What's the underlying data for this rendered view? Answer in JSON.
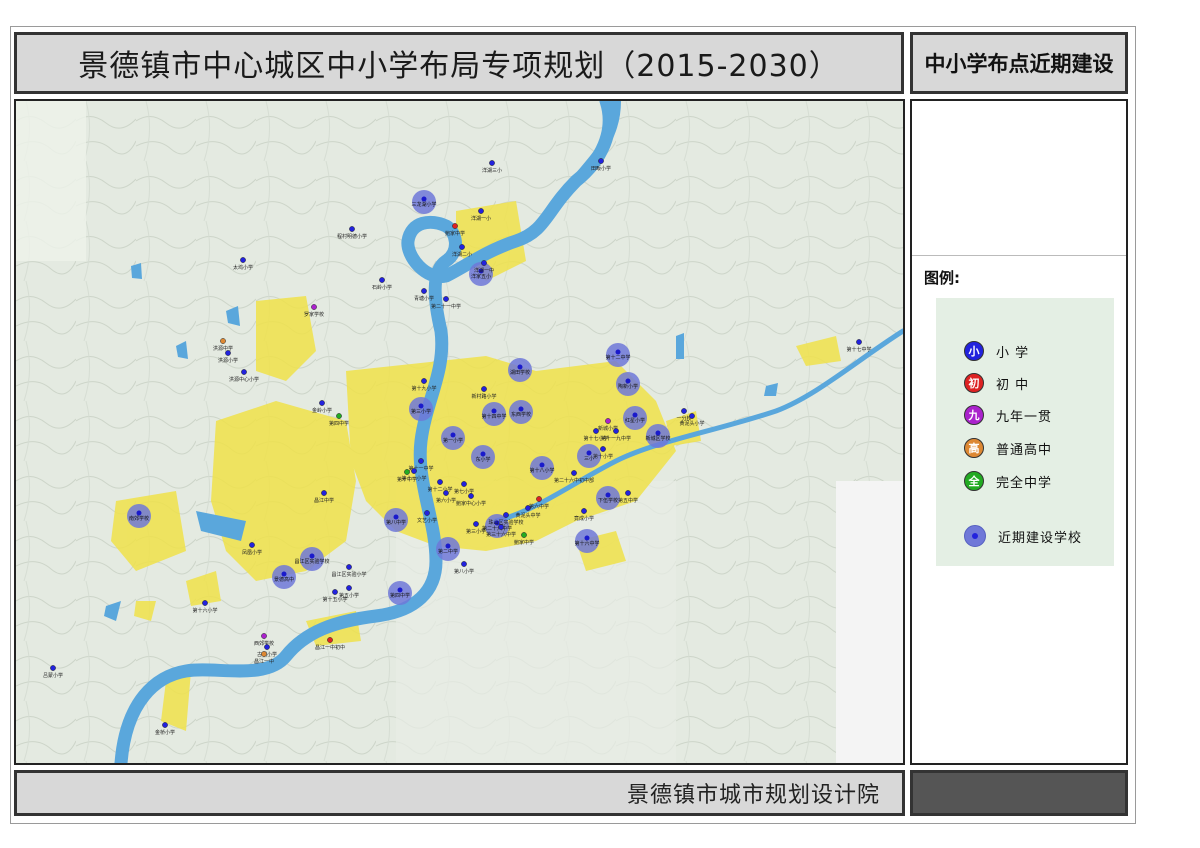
{
  "header": {
    "title": "景德镇市中心城区中小学布局专项规划（2015-2030）",
    "subtitle": "中小学布点近期建设"
  },
  "legend": {
    "title": "图例:",
    "items": [
      {
        "glyph": "小",
        "label": "小    学",
        "color": "#2222dd"
      },
      {
        "glyph": "初",
        "label": "初    中",
        "color": "#dd2222"
      },
      {
        "glyph": "九",
        "label": "九年一贯",
        "color": "#aa22cc"
      },
      {
        "glyph": "高",
        "label": "普通高中",
        "color": "#dd8833"
      },
      {
        "glyph": "全",
        "label": "完全中学",
        "color": "#22aa22"
      }
    ],
    "planned": {
      "label": "近期建设学校",
      "color": "#6f78d8"
    }
  },
  "footer": {
    "institute": "景德镇市城市规划设计院"
  },
  "colors": {
    "river": "#5aa7dc",
    "urban": "#f0e24a",
    "terrain": "#dfe6dc",
    "planned_circle": "#6f78d8"
  },
  "map": {
    "planned_schools": [
      {
        "label": "三龙湖小学"
      },
      {
        "label": "洋家五小"
      },
      {
        "label": "南郊学校"
      },
      {
        "label": "第十二中学"
      },
      {
        "label": "陶新小学"
      },
      {
        "label": "新城区学校"
      },
      {
        "label": "第三小学"
      },
      {
        "label": "第一小学"
      },
      {
        "label": "第十四中学"
      },
      {
        "label": "东小学"
      },
      {
        "label": "湖田学校"
      },
      {
        "label": "第十八小学"
      },
      {
        "label": "三小"
      },
      {
        "label": "第二十六中学"
      },
      {
        "label": "第二中学"
      },
      {
        "label": "下伍学校"
      },
      {
        "label": "第十六中学"
      },
      {
        "label": "第八中学"
      },
      {
        "label": "第四中学"
      },
      {
        "label": "昌江区实验学校"
      },
      {
        "label": "景德高中"
      },
      {
        "label": "红星小学"
      },
      {
        "label": "东西学校"
      }
    ],
    "schools": [
      {
        "label": "洋湖三小",
        "type": "小"
      },
      {
        "label": "田畈小学",
        "type": "小"
      },
      {
        "label": "洋湖一小",
        "type": "小"
      },
      {
        "label": "鲍家中学",
        "type": "初"
      },
      {
        "label": "洋湖二小",
        "type": "小"
      },
      {
        "label": "洋湖一中",
        "type": "小"
      },
      {
        "label": "程村明德小学",
        "type": "小"
      },
      {
        "label": "石岭小学",
        "type": "小"
      },
      {
        "label": "青塘小学",
        "type": "小"
      },
      {
        "label": "第二十一中学",
        "type": "小"
      },
      {
        "label": "太坞小学",
        "type": "小"
      },
      {
        "label": "罗家学校",
        "type": "九"
      },
      {
        "label": "洪源中学",
        "type": "高"
      },
      {
        "label": "洪源小学",
        "type": "小"
      },
      {
        "label": "洪源中心小学",
        "type": "小"
      },
      {
        "label": "金岭小学",
        "type": "小"
      },
      {
        "label": "第四中学",
        "type": "全"
      },
      {
        "label": "第十九小学",
        "type": "小"
      },
      {
        "label": "新村路小学",
        "type": "小"
      },
      {
        "label": "第十一中学",
        "type": "小"
      },
      {
        "label": "第十一小学",
        "type": "小"
      },
      {
        "label": "第十中学",
        "type": "全"
      },
      {
        "label": "第十二小学",
        "type": "小"
      },
      {
        "label": "第六小学",
        "type": "小"
      },
      {
        "label": "第七小学",
        "type": "小"
      },
      {
        "label": "文艺小学",
        "type": "小"
      },
      {
        "label": "第三小学",
        "type": "小"
      },
      {
        "label": "第三十六中学",
        "type": "小"
      },
      {
        "label": "第八小学",
        "type": "小"
      },
      {
        "label": "昌江区实验小学",
        "type": "小"
      },
      {
        "label": "第五小学",
        "type": "小"
      },
      {
        "label": "第十五小学",
        "type": "小"
      },
      {
        "label": "第十六小学",
        "type": "小"
      },
      {
        "label": "西郊学校",
        "type": "九"
      },
      {
        "label": "古城小学",
        "type": "小"
      },
      {
        "label": "昌江一中",
        "type": "高"
      },
      {
        "label": "昌江一中初中",
        "type": "初"
      },
      {
        "label": "吕蒙小学",
        "type": "小"
      },
      {
        "label": "金桥小学",
        "type": "小"
      },
      {
        "label": "凤凰小学",
        "type": "小"
      },
      {
        "label": "昌江中学",
        "type": "小"
      },
      {
        "label": "新城小学",
        "type": "九"
      },
      {
        "label": "第十一九中学",
        "type": "小"
      },
      {
        "label": "第十七小学",
        "type": "小"
      },
      {
        "label": "第十小学",
        "type": "小"
      },
      {
        "label": "一分校",
        "type": "小"
      },
      {
        "label": "黄泥头小学",
        "type": "小"
      },
      {
        "label": "黄泥头中学",
        "type": "小"
      },
      {
        "label": "竟成小学",
        "type": "小"
      },
      {
        "label": "珠山区实验学校",
        "type": "小"
      },
      {
        "label": "第二十六中初中部",
        "type": "小"
      },
      {
        "label": "第十七中学",
        "type": "小"
      },
      {
        "label": "鲍家中心小学",
        "type": "小"
      },
      {
        "label": "鲍家中学",
        "type": "全"
      },
      {
        "label": "第六中学",
        "type": "初"
      },
      {
        "label": "第五中学",
        "type": "小"
      }
    ]
  }
}
